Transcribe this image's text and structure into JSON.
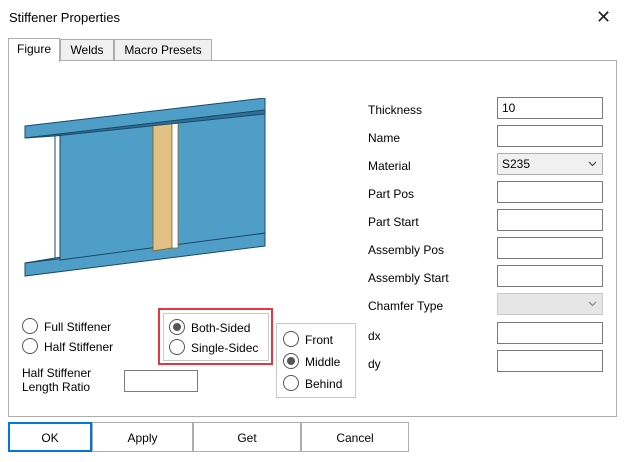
{
  "window": {
    "title": "Stiffener Properties"
  },
  "tabs": [
    "Figure",
    "Welds",
    "Macro Presets"
  ],
  "fields": {
    "thickness_label": "Thickness",
    "thickness_value": "10",
    "name_label": "Name",
    "name_value": "",
    "material_label": "Material",
    "material_value": "S235",
    "part_pos_label": "Part Pos",
    "part_pos_value": "",
    "part_start_label": "Part Start",
    "part_start_value": "",
    "assembly_pos_label": "Assembly Pos",
    "assembly_pos_value": "",
    "assembly_start_label": "Assembly Start",
    "assembly_start_value": "",
    "chamfer_type_label": "Chamfer Type",
    "chamfer_type_value": "",
    "dx_label": "dx",
    "dx_value": "",
    "dy_label": "dy",
    "dy_value": ""
  },
  "stiffener_type": {
    "full_label": "Full Stiffener",
    "half_label": "Half Stiffener",
    "half_ratio_label_line1": "Half Stiffener",
    "half_ratio_label_line2": "Length Ratio",
    "half_ratio_value": ""
  },
  "sides": {
    "both_label": "Both-Sided",
    "single_label": "Single-Sidec",
    "selected": "both"
  },
  "position": {
    "front_label": "Front",
    "middle_label": "Middle",
    "behind_label": "Behind",
    "selected": "middle"
  },
  "buttons": {
    "ok": "OK",
    "apply": "Apply",
    "get": "Get",
    "cancel": "Cancel"
  },
  "colors": {
    "beam": "#4f9ec8",
    "beam_dark": "#2f6f99",
    "stiffener": "#e2c185",
    "highlight": "#e0383e"
  }
}
